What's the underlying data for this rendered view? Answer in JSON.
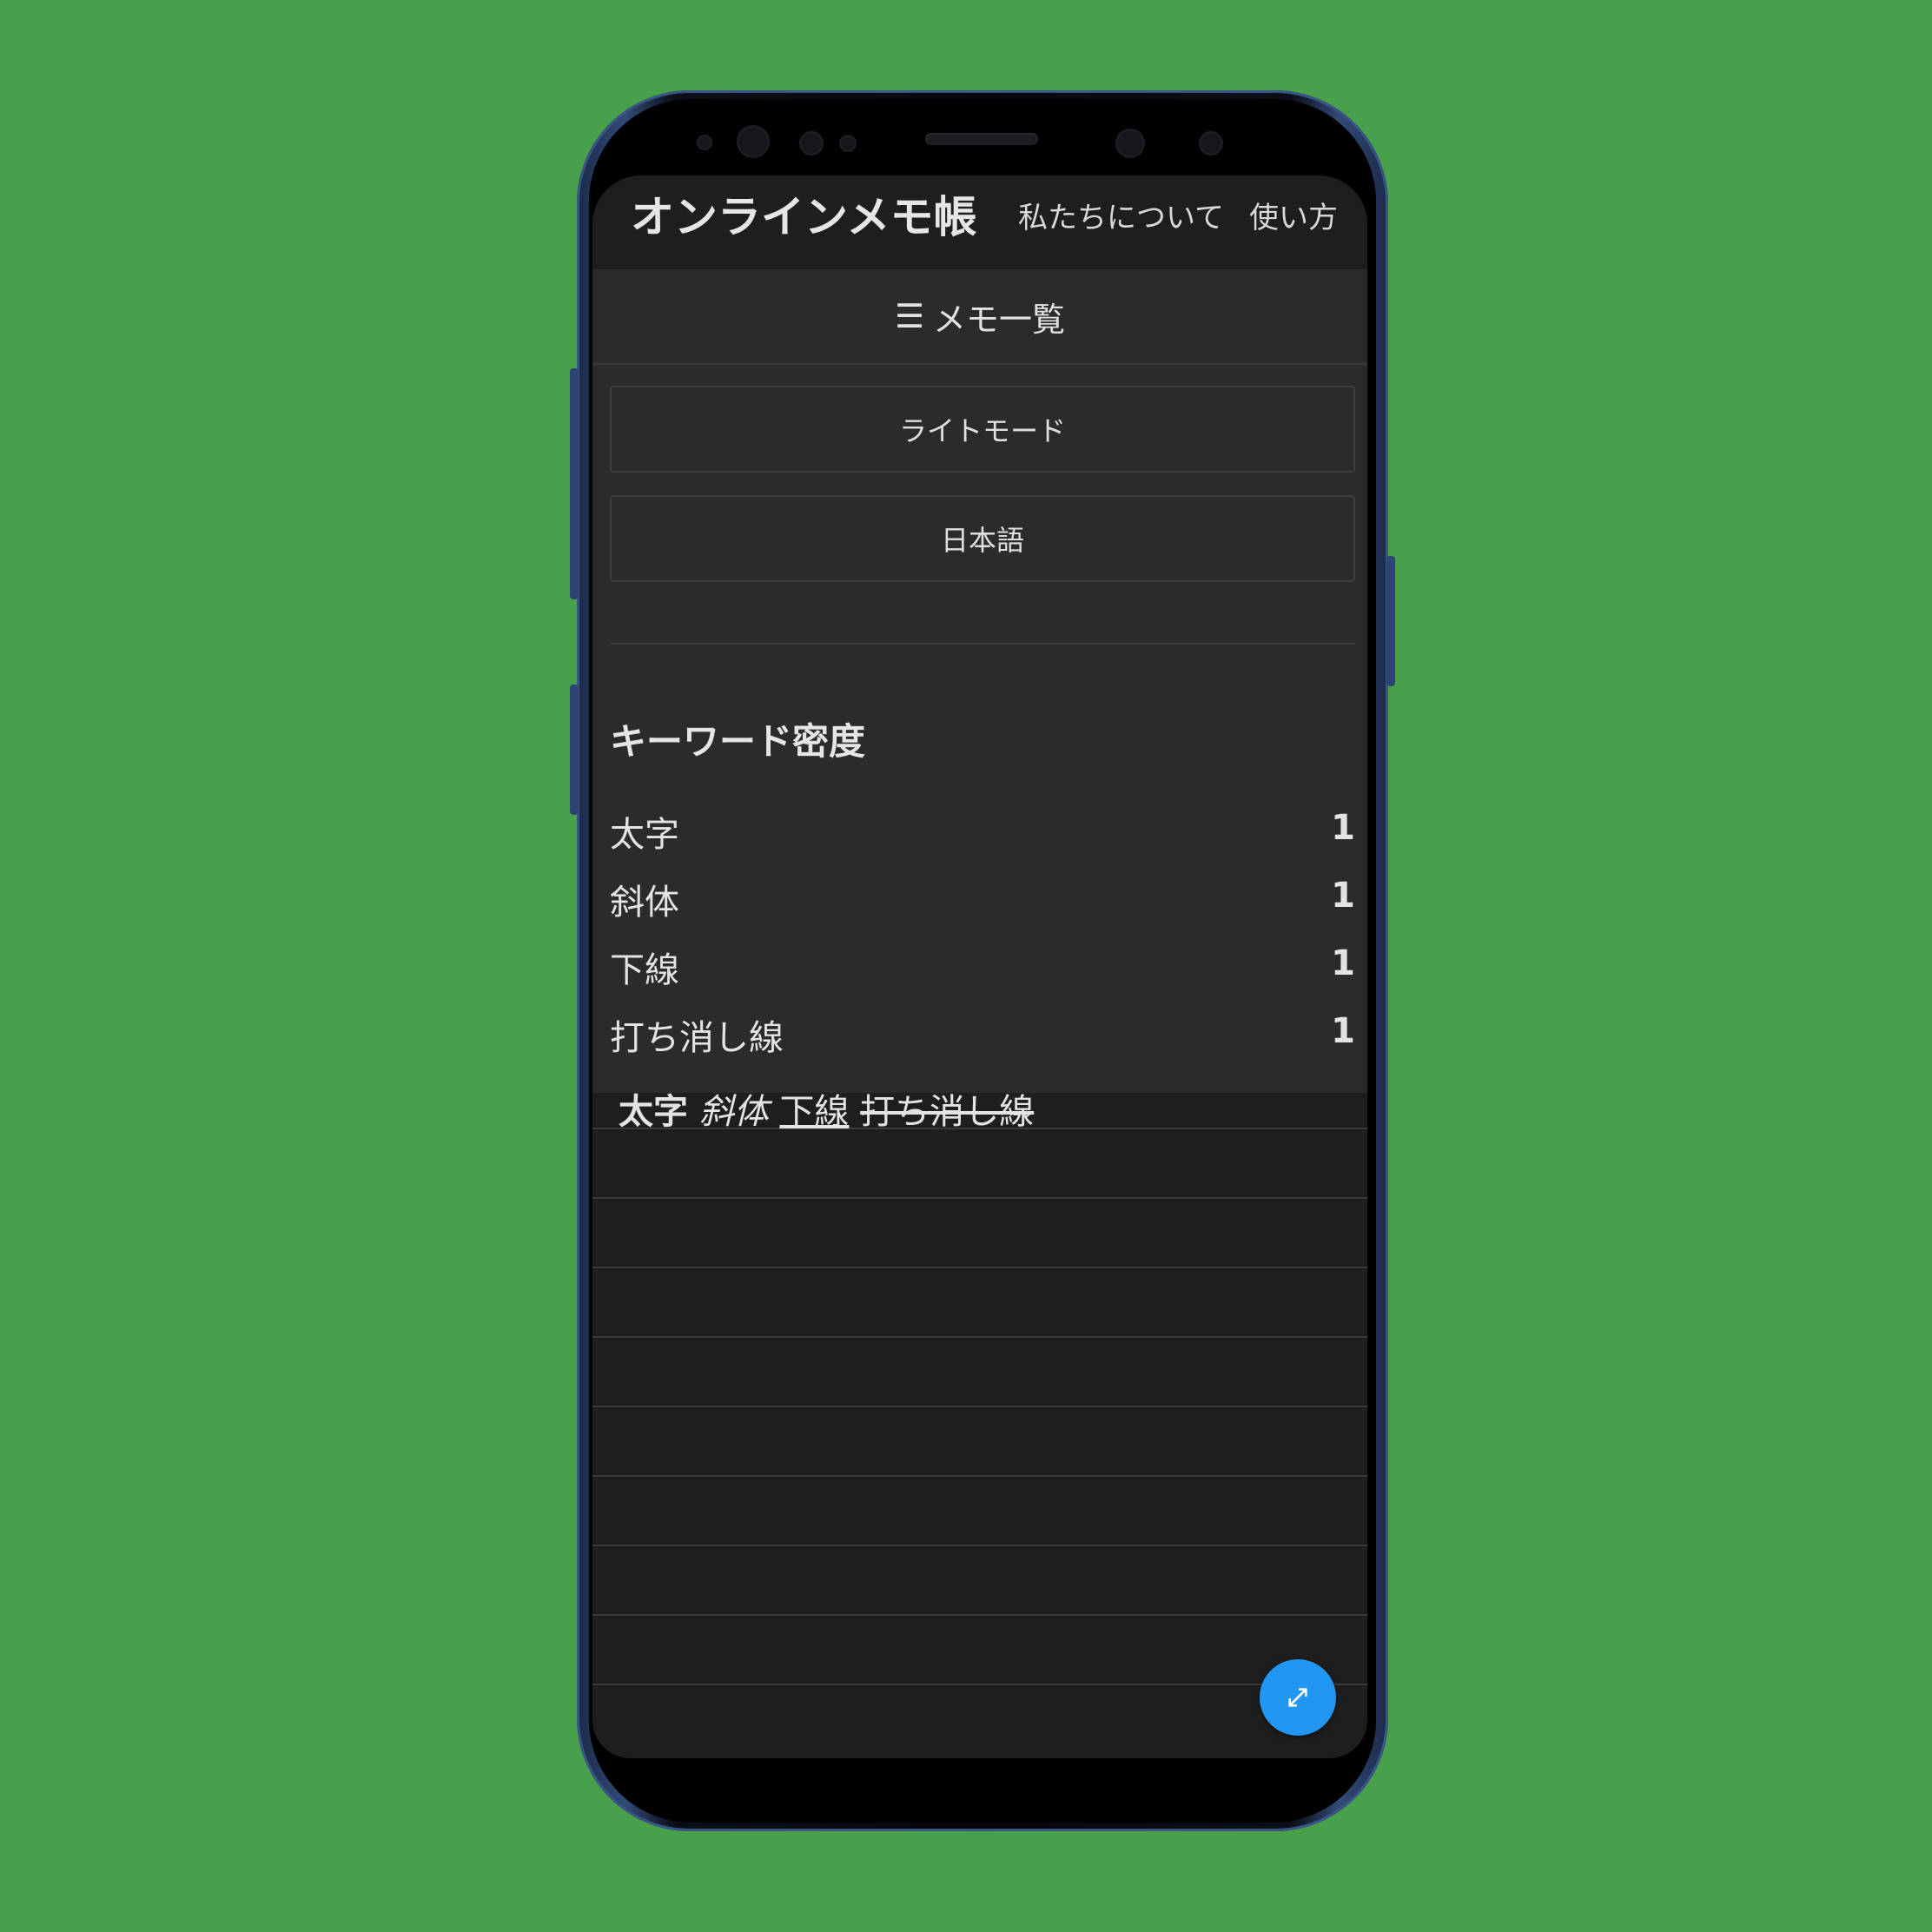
{
  "app": {
    "title": "オンラインメモ帳",
    "nav": {
      "about": "私たちについて",
      "howto": "使い方"
    }
  },
  "panel": {
    "memo_list_icon": "☰",
    "memo_list_label": "メモ一覧",
    "light_mode_label": "ライトモード",
    "language_label": "日本語",
    "keyword_density": {
      "title": "キーワード密度",
      "items": [
        {
          "word": "太字",
          "count": "1"
        },
        {
          "word": "斜体",
          "count": "1"
        },
        {
          "word": "下線",
          "count": "1"
        },
        {
          "word": "打ち消し線",
          "count": "1"
        }
      ]
    }
  },
  "editor": {
    "bold": "太字",
    "italic": "斜体",
    "underline": "下線",
    "strike": "打ち消し線"
  },
  "fab": {
    "icon": "expand-arrows-icon"
  },
  "colors": {
    "background": "#48a04b",
    "panel": "#2b2b2b",
    "editor": "#1e1e1e",
    "fab": "#2196f3"
  }
}
